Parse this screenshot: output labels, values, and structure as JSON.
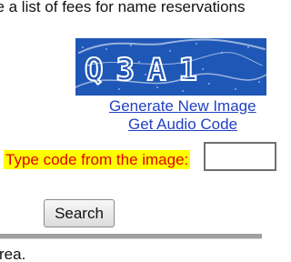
{
  "intro_text": "ee a list of fees for name reservations",
  "captcha": {
    "image_text": "Q3A1",
    "colors": {
      "background": "#1f57b6",
      "glyph": "#ffffff"
    }
  },
  "links": {
    "generate": "Generate New Image",
    "audio": "Get Audio Code"
  },
  "code_prompt": "Type code from the image:",
  "code_input_value": "",
  "search_label": "Search",
  "footer_text": "rea.",
  "colors": {
    "link": "#2241c2",
    "prompt_text": "#e00000",
    "prompt_highlight": "#ffff00"
  }
}
